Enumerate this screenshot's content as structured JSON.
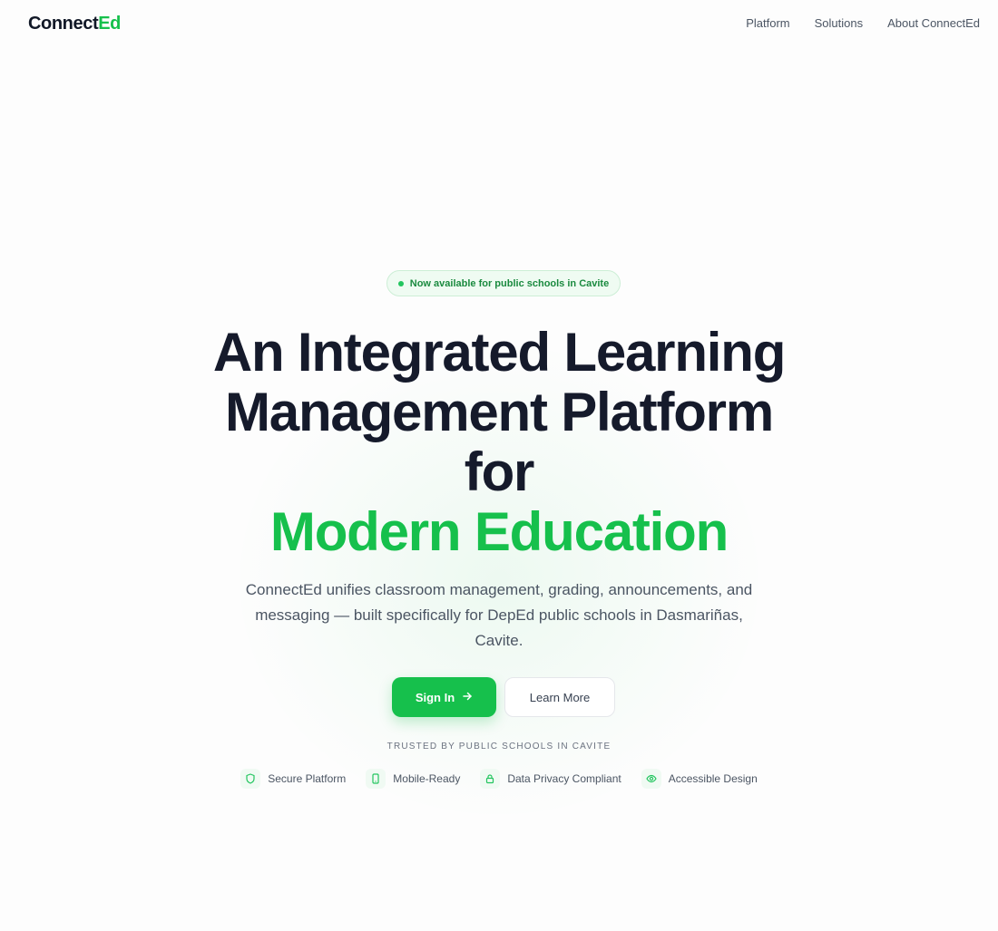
{
  "nav": {
    "logo_primary": "Connect",
    "logo_accent": "Ed",
    "links": [
      "Platform",
      "Solutions",
      "About ConnectEd"
    ]
  },
  "hero": {
    "badge": "Now available for public schools in Cavite",
    "headline_lines": [
      "An Integrated Learning",
      "Management Platform",
      "for"
    ],
    "headline_accent": "Modern Education",
    "subtext": "ConnectEd unifies classroom management, grading, announcements, and messaging — built specifically for DepEd public schools in Dasmariñas, Cavite.",
    "primary_button": "Sign In",
    "secondary_button": "Learn More",
    "trusted_label": "TRUSTED BY PUBLIC SCHOOLS IN CAVITE",
    "features": [
      {
        "label": "Secure Platform",
        "icon": "shield-icon"
      },
      {
        "label": "Mobile-Ready",
        "icon": "smartphone-icon"
      },
      {
        "label": "Data Privacy Compliant",
        "icon": "lock-icon"
      },
      {
        "label": "Accessible Design",
        "icon": "eye-icon"
      }
    ]
  },
  "colors": {
    "accent": "#16c04c",
    "text_dark": "#151a2b",
    "text_muted": "#4b5563"
  }
}
